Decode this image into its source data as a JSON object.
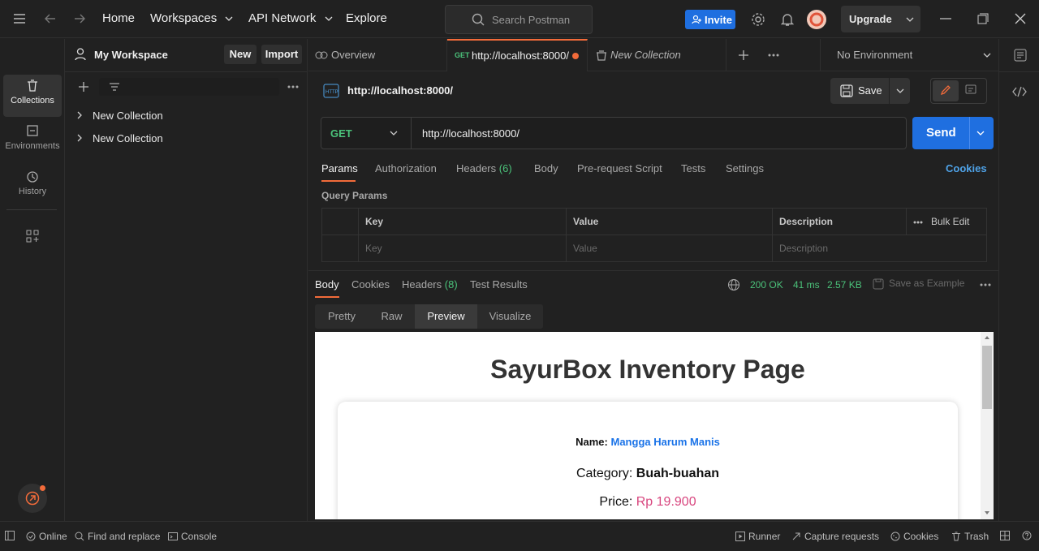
{
  "topbar": {
    "nav": {
      "home": "Home",
      "workspaces": "Workspaces",
      "api_network": "API Network",
      "explore": "Explore"
    },
    "search_placeholder": "Search Postman",
    "invite": "Invite",
    "upgrade": "Upgrade",
    "accent": "#1f6fe0"
  },
  "sidebar": {
    "workspace": "My Workspace",
    "new_label": "New",
    "import_label": "Import",
    "collections": [
      {
        "name": "New Collection"
      },
      {
        "name": "New Collection"
      }
    ]
  },
  "rail": {
    "items": [
      {
        "label": "Collections"
      },
      {
        "label": "Environments"
      },
      {
        "label": "History"
      }
    ]
  },
  "tabs": {
    "overview": "Overview",
    "request_method": "GET",
    "request_url": "http://localhost:8000/",
    "collection_tab": "New Collection",
    "environment": "No Environment"
  },
  "request": {
    "title": "http://localhost:8000/",
    "save": "Save",
    "method": "GET",
    "url": "http://localhost:8000/",
    "send": "Send",
    "tabs": [
      "Params",
      "Authorization",
      "Headers",
      "Body",
      "Pre-request Script",
      "Tests",
      "Settings"
    ],
    "headers_count": "(6)",
    "cookies": "Cookies",
    "query_params_title": "Query Params",
    "columns": {
      "key": "Key",
      "value": "Value",
      "description": "Description",
      "bulk_edit": "Bulk Edit"
    },
    "placeholders": {
      "key": "Key",
      "value": "Value",
      "description": "Description"
    }
  },
  "response": {
    "tabs": {
      "body": "Body",
      "cookies": "Cookies",
      "headers": "Headers",
      "headers_count": "(8)",
      "test_results": "Test Results"
    },
    "status": "200 OK",
    "time": "41 ms",
    "size": "2.57 KB",
    "save_example": "Save as Example",
    "formats": [
      "Pretty",
      "Raw",
      "Preview",
      "Visualize"
    ],
    "preview": {
      "heading": "SayurBox Inventory Page",
      "name_label": "Name:",
      "name_value": "Mangga Harum Manis",
      "category_label": "Category:",
      "category_value": "Buah-buahan",
      "price_label": "Price:",
      "price_value": "Rp 19.900"
    }
  },
  "statusbar": {
    "online": "Online",
    "find_replace": "Find and replace",
    "console": "Console",
    "runner": "Runner",
    "capture": "Capture requests",
    "cookies": "Cookies",
    "trash": "Trash"
  }
}
